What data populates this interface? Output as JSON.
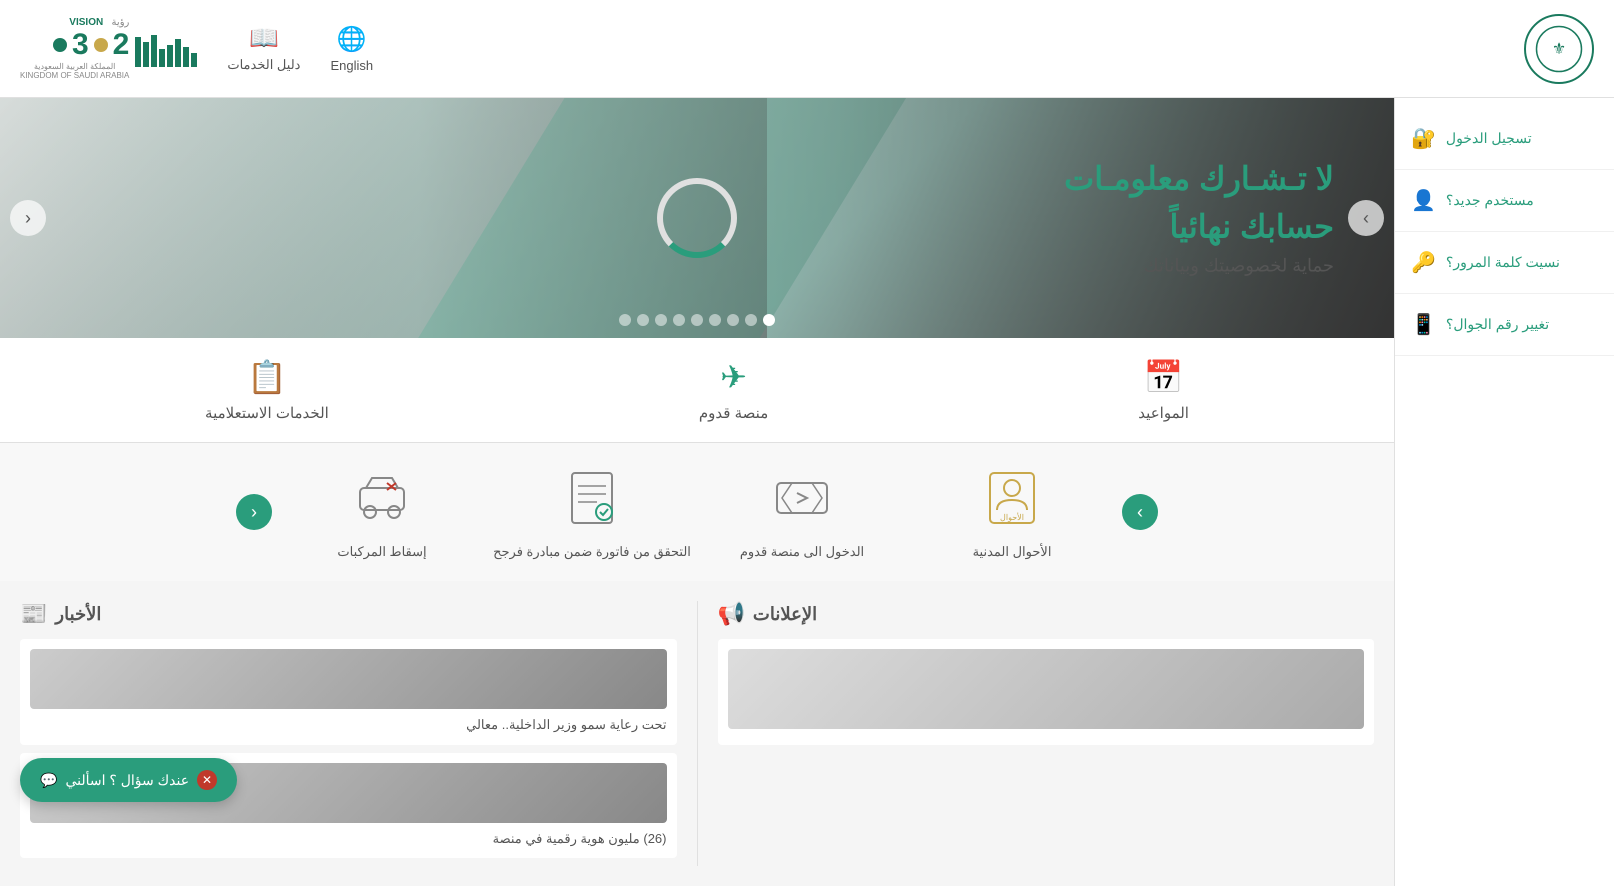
{
  "header": {
    "logo_alt": "Saudi Arabia Ministry of Interior",
    "nav_english": "English",
    "nav_services_guide": "دليل الخدمات",
    "vision_label": "رؤية",
    "vision_year": "2030",
    "ksa_label": "المملكة العربية السعودية",
    "ksa_label_en": "KINGDOM OF SAUDI ARABIA"
  },
  "sidebar": {
    "chevron_icon": "‹",
    "items": [
      {
        "id": "login",
        "label": "تسجيل الدخول",
        "icon": "🔐"
      },
      {
        "id": "new-user",
        "label": "مستخدم جديد؟",
        "icon": "👤"
      },
      {
        "id": "forgot-password",
        "label": "نسيت كلمة المرور؟",
        "icon": "🔑"
      },
      {
        "id": "change-mobile",
        "label": "تغيير رقم الجوال؟",
        "icon": "📱"
      }
    ]
  },
  "banner": {
    "title": "لا تـشـارك معلومـات",
    "title_line2": "حسابك نهائياً",
    "subtitle": "حماية لخصوصيتك وبياناتك",
    "prev_btn": "›",
    "next_btn": "‹",
    "dots_count": 9,
    "active_dot": 0
  },
  "quick_links": [
    {
      "id": "appointments",
      "label": "المواعيد",
      "icon": "📅"
    },
    {
      "id": "arrival-platform",
      "label": "منصة قدوم",
      "icon": "✈"
    },
    {
      "id": "inquiry-services",
      "label": "الخدمات الاستعلامية",
      "icon": "📋"
    }
  ],
  "services": {
    "prev_btn": "›",
    "next_btn": "‹",
    "items": [
      {
        "id": "civil-status",
        "label": "الأحوال المدنية",
        "icon": "📄"
      },
      {
        "id": "arrival-login",
        "label": "الدخول الى منصة قدوم",
        "icon": "✈"
      },
      {
        "id": "bill-check",
        "label": "التحقق من فاتورة ضمن مبادرة فرجح",
        "icon": "🧾"
      },
      {
        "id": "vehicle-scrapping",
        "label": "إسقاط المركبات",
        "icon": "🚗"
      }
    ]
  },
  "bottom": {
    "news_title": "الأخبار",
    "news_icon": "📰",
    "news_items": [
      {
        "id": "news-1",
        "text": "تحت رعاية سمو وزير الداخلية.. معالي"
      },
      {
        "id": "news-2",
        "text": "(26) مليون هوية رقمية في منصة"
      }
    ],
    "promo_title": "الإعلانات",
    "promo_icon": "📢",
    "promo_items": [
      {
        "id": "promo-1",
        "text": ""
      }
    ]
  },
  "chat_button": {
    "label": "عندك سؤال ؟ اسألني",
    "close_icon": "✕"
  }
}
